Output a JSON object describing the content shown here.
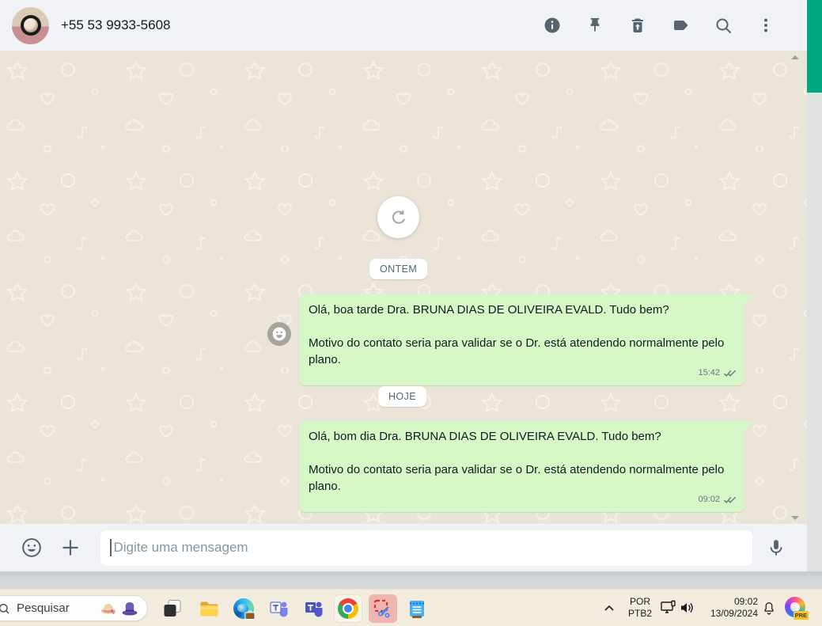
{
  "header": {
    "phone": "+55 53 9933-5608",
    "icons": [
      "info-icon",
      "pin-icon",
      "delete-icon",
      "label-icon",
      "search-icon",
      "kebab-menu-icon"
    ]
  },
  "chat": {
    "dividers": {
      "yesterday": "ONTEM",
      "today": "HOJE"
    },
    "messages": [
      {
        "p1": "Olá, boa tarde Dra.  BRUNA DIAS DE OLIVEIRA EVALD. Tudo bem?",
        "p2": "Motivo do contato seria para validar se o Dr. está atendendo normalmente pelo plano.",
        "time": "15:42",
        "status": "delivered-double-check"
      },
      {
        "p1": "Olá, bom dia  Dra.  BRUNA DIAS DE OLIVEIRA EVALD. Tudo bem?",
        "p2": "Motivo do contato seria para validar se o Dr. está atendendo normalmente pelo plano.",
        "time": "09:02",
        "status": "delivered-double-check"
      }
    ]
  },
  "composer": {
    "placeholder": "Digite uma mensagem"
  },
  "taskbar": {
    "search_label": "Pesquisar",
    "pinned_apps": [
      "task-view",
      "file-explorer",
      "edge-work",
      "teams",
      "teams-alt",
      "chrome",
      "snipping-tool",
      "notepad"
    ],
    "tray": {
      "language": "POR",
      "keyboard": "PTB2",
      "time": "09:02",
      "date": "13/09/2024",
      "copilot_badge": "PRE"
    }
  },
  "colors": {
    "whatsapp_teal": "#00a884",
    "bubble_green": "#d5f8c6",
    "header_bg": "#f0f2f5",
    "chat_bg": "#ebe4d9",
    "icon_slate": "#54656f",
    "taskbar_bg": "#f2ecdf",
    "meta_gray": "#667781"
  }
}
